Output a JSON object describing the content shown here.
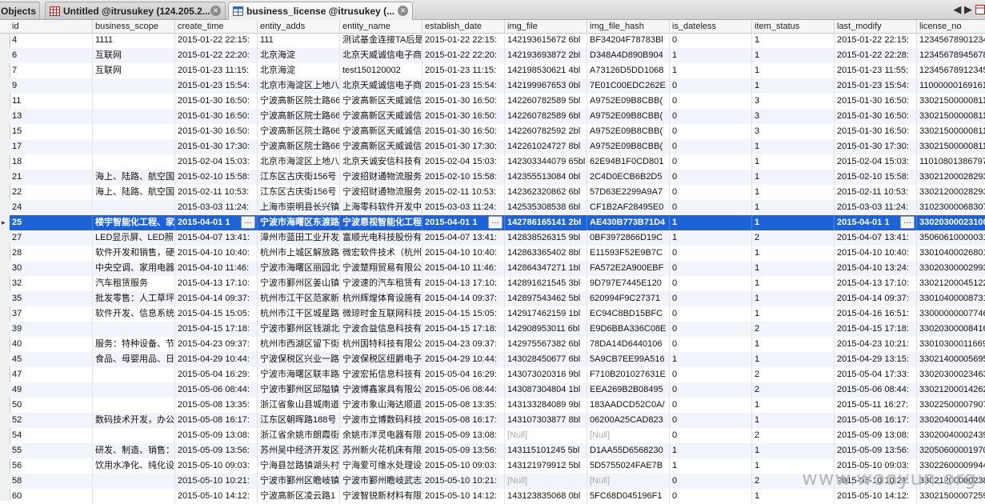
{
  "tabs": [
    {
      "label": "Objects",
      "icon": "objects-tab"
    },
    {
      "label": "Untitled @itrusukey (124.205.2...",
      "icon": "query-icon"
    },
    {
      "label": "business_license @itrusukey (...",
      "icon": "table-icon"
    }
  ],
  "tab_nav": {
    "arrows": "◀ ▶"
  },
  "columns": [
    "id",
    "business_scope",
    "create_time",
    "entity_adds",
    "entity_name",
    "establish_date",
    "img_file",
    "img_file_hash",
    "is_dateless",
    "item_status",
    "last_modify",
    "license_no"
  ],
  "rows": [
    [
      "4",
      "1111",
      "2015-01-22 22:15:",
      "111",
      "测试基金连接TA后是",
      "2015-01-22 22:15:",
      "142193615672 6bl",
      "BF34204F78783Bl",
      "0",
      "1",
      "2015-01-22 22:15:",
      "12345678901234"
    ],
    [
      "6",
      "互联网",
      "2015-01-22 22:20:",
      "北京海淀",
      "北京天威诚信电子商",
      "2015-01-22 22:20:",
      "142193693872 2bl",
      "D348A4D890B904",
      "1",
      "1",
      "2015-01-22 22:28:",
      "12345678945678"
    ],
    [
      "7",
      "互联网",
      "2015-01-23 11:15:",
      "北京海淀",
      "test150120002",
      "2015-01-23 11:15:",
      "142198530621 4bl",
      "A73126D5DD1068",
      "1",
      "1",
      "2015-01-23 11:55:",
      "12345678912345"
    ],
    [
      "9",
      "",
      "2015-01-23 15:54:",
      "北京市海淀区上地八",
      "北京天威诚信电子商",
      "2015-01-23 15:54:",
      "142199967653 0bl",
      "7E01C00EDC262E",
      "0",
      "1",
      "2015-01-23 15:54:",
      "11000000169161"
    ],
    [
      "11",
      "",
      "2015-01-30 16:50:",
      "宁波高新区院士路66",
      "宁波高新区天威诚信",
      "2015-01-30 16:50:",
      "142260782589 5bl",
      "A9752E09B8CBB(",
      "0",
      "3",
      "2015-01-30 16:50:",
      "33021500000811"
    ],
    [
      "13",
      "",
      "2015-01-30 16:50:",
      "宁波高新区院士路66",
      "宁波高新区天威诚信",
      "2015-01-30 16:50:",
      "142260782589 6bl",
      "A9752E09B8CBB(",
      "0",
      "3",
      "2015-01-30 16:50:",
      "33021500000811"
    ],
    [
      "15",
      "",
      "2015-01-30 16:50:",
      "宁波高新区院士路66",
      "宁波高新区天威诚信",
      "2015-01-30 16:50:",
      "142260782592 2bl",
      "A9752E09B8CBB(",
      "0",
      "3",
      "2015-01-30 16:50:",
      "33021500000811"
    ],
    [
      "17",
      "",
      "2015-01-30 17:30:",
      "宁波高新区院士路66",
      "宁波高新区天威诚信",
      "2015-01-30 17:30:",
      "142261024727 8bl",
      "A9752E09B8CBB(",
      "0",
      "1",
      "2015-01-30 17:30:",
      "33021500000811"
    ],
    [
      "18",
      "",
      "2015-02-04 15:03:",
      "北京市海淀区上地八",
      "北京天诚安信科技有",
      "2015-02-04 15:03:",
      "142303344079 65bl",
      "62E94B1F0CD801",
      "0",
      "1",
      "2015-02-04 15:03:",
      "11010801386797"
    ],
    [
      "21",
      "海上、陆路、航空国",
      "2015-02-10 15:58:",
      "江东区古庆街156号",
      "宁波招财通物流服务",
      "2015-02-10 15:58:",
      "142355513084 0bl",
      "2C4D0ECB6B2D5",
      "0",
      "1",
      "2015-02-10 15:58:",
      "33021200028293"
    ],
    [
      "22",
      "海上、陆路、航空国",
      "2015-02-11 10:53:",
      "江东区古庆街156号",
      "宁波招财通物流服务",
      "2015-02-11 10:53:",
      "142362320862 6bl",
      "57D63E2299A9A7",
      "0",
      "1",
      "2015-02-11 10:53:",
      "33021200028293"
    ],
    [
      "24",
      "",
      "2015-03-03 11:24:",
      "上海市崇明县长兴镇",
      "上海零科软件开发中",
      "2015-03-03 11:24:",
      "142535308538 6bl",
      "CF1B2AF28495E0",
      "0",
      "1",
      "2015-03-03 11:24:",
      "31023000068307"
    ],
    [
      "25",
      "楼宇智能化工程、家",
      "2015-04-01 1",
      "宁波市海曙区东渡路",
      "宁波恩视智能化工程",
      "2015-04-01 1",
      "142786165141 2bl",
      "AE430B773B71D4",
      "1",
      "1",
      "2015-04-01 1",
      "33020300023100"
    ],
    [
      "27",
      "LED显示屏、LED照",
      "2015-04-07 13:41:",
      "漳州市蓝田工业开发",
      "富顺光电科技股份有",
      "2015-04-07 13:41:",
      "142838526315 9bl",
      "0BF3972866D19C",
      "1",
      "2",
      "2015-04-07 13:41:",
      "35060610000031"
    ],
    [
      "28",
      "软件开发和销售，硬",
      "2015-04-10 10:40:",
      "杭州市上城区解放路",
      "微宏软件技术（杭州",
      "2015-04-10 10:40:",
      "142863365402 8bl",
      "E11593F52E9B7C",
      "0",
      "1",
      "2015-04-10 10:40:",
      "33010400026801"
    ],
    [
      "30",
      "中央空调、家用电器",
      "2015-04-10 11:46:",
      "宁波市海曙区丽园北",
      "宁波楚翔贸易有限公",
      "2015-04-10 11:46:",
      "142864347271 1bl",
      "FA572E2A900EBF",
      "0",
      "1",
      "2015-04-10 13:24:",
      "33020300002993"
    ],
    [
      "32",
      "汽车租赁服务",
      "2015-04-13 17:10:",
      "宁波市鄞州区姜山镇",
      "宁波速的汽车租赁有",
      "2015-04-13 17:10:",
      "142891621545 3bl",
      "9D797E7445E120",
      "0",
      "1",
      "2015-04-13 17:10:",
      "33021200045122"
    ],
    [
      "35",
      "批发零售：人工草坪",
      "2015-04-14 09:37:",
      "杭州市江干区范家新",
      "杭州辉煌体育设施有",
      "2015-04-14 09:37:",
      "142897543462 5bl",
      "620994F9C27371",
      "0",
      "1",
      "2015-04-14 09:37:",
      "33010400008731"
    ],
    [
      "37",
      "软件开发、信息系统",
      "2015-04-15 15:05:",
      "杭州市江干区城星路",
      "微琼时金互联网科技",
      "2015-04-15 15:05:",
      "142917462159 1bl",
      "EC94C8BD15BFC",
      "0",
      "1",
      "2015-04-16 16:51:",
      "33000000007746"
    ],
    [
      "39",
      "",
      "2015-04-15 17:18:",
      "宁波市鄞州区钱湖北",
      "宁波合益信息科技有",
      "2015-04-15 17:18:",
      "142908953011 6bl",
      "E9D6BBA336C08E",
      "0",
      "2",
      "2015-04-15 17:18:",
      "33020300008416"
    ],
    [
      "40",
      "服务：特种设备、节",
      "2015-04-23 09:37:",
      "杭州市西湖区留下街",
      "杭州国特科技有限公",
      "2015-04-23 09:37:",
      "142975567382 6bl",
      "78DA14D6440106",
      "0",
      "1",
      "2015-04-23 10:21:",
      "33010300011669"
    ],
    [
      "45",
      "食品、母婴用品、日",
      "2015-04-29 10:44:",
      "宁波保税区兴业一路",
      "宁波保税区纽爵电子",
      "2015-04-29 10:44:",
      "143028450677 6bl",
      "5A9CB7EE99A516",
      "1",
      "1",
      "2015-04-29 13:15:",
      "33021400005695"
    ],
    [
      "47",
      "",
      "2015-05-04 16:29:",
      "宁波市海曙区联丰路",
      "宁波宏拓信息科技有",
      "2015-05-04 16:29:",
      "143073020316 9bl",
      "F710B201027631E",
      "0",
      "2",
      "2015-05-04 17:33:",
      "33020300023463"
    ],
    [
      "49",
      "",
      "2015-05-06 08:44:",
      "宁波市鄞州区邱隘镇",
      "宁波博鑫家具有限公",
      "2015-05-06 08:44:",
      "143087304804 1bl",
      "EEA269B2B08495",
      "0",
      "2",
      "2015-05-06 08:44:",
      "33021200014262"
    ],
    [
      "50",
      "",
      "2015-05-08 13:35:",
      "浙江省象山县城南道",
      "宁波市象山海达顺道",
      "2015-05-08 13:35:",
      "143133284089 9bl",
      "183AADCD52C0A/",
      "0",
      "1",
      "2015-05-11 16:27:",
      "33022500007907"
    ],
    [
      "52",
      "数码技术开发，办公",
      "2015-05-08 16:17:",
      "江东区朝晖路188号",
      "宁波市立博数码科技",
      "2015-05-08 16:17:",
      "143107303877 8bl",
      "06200A25CAD823",
      "0",
      "1",
      "2015-05-08 16:17:",
      "33020400014460"
    ],
    [
      "54",
      "",
      "2015-05-09 13:08:",
      "浙江省余姚市朗霞街",
      "余姚市洋灵电器有限",
      "2015-05-09 13:08:",
      "[Null]",
      "[Null]",
      "0",
      "2",
      "2015-05-09 13:08:",
      "33020040002439"
    ],
    [
      "55",
      "研发、制造、销售：",
      "2015-05-09 13:56:",
      "苏州吴中经济开发区",
      "苏州新火花机床有限",
      "2015-05-09 13:56:",
      "143115101245 5bl",
      "D1AA55D6568230",
      "1",
      "1",
      "2015-05-09 13:56:",
      "32050600001970"
    ],
    [
      "56",
      "饮用水净化、纯化设",
      "2015-05-10 09:03:",
      "宁海县岔路镇湖头村",
      "宁海爱可维水处理设",
      "2015-05-10 09:03:",
      "143121979912 5bl",
      "5D5755024FAE7B",
      "1",
      "1",
      "2015-05-10 09:03:",
      "33022600009944"
    ],
    [
      "58",
      "",
      "2015-05-10 10:21:",
      "宁波市鄞州区瞻岐镇",
      "宁波市鄞州瞻岐武志",
      "2015-05-10 10:21:",
      "[Null]",
      "[Null]",
      "0",
      "2",
      "2015-05-10 10:21:",
      "33021200000238"
    ],
    [
      "60",
      "",
      "2015-05-10 14:12:",
      "宁波高新区凌云路1",
      "宁波智锐新材料有限",
      "2015-05-10 14:12:",
      "143123835068 0bl",
      "5FC68D045196F1",
      "0",
      "1",
      "2015-05-10 14:12:",
      "33021500007259"
    ]
  ],
  "selected_row_index": 12,
  "watermark": "www.wooyun.org"
}
